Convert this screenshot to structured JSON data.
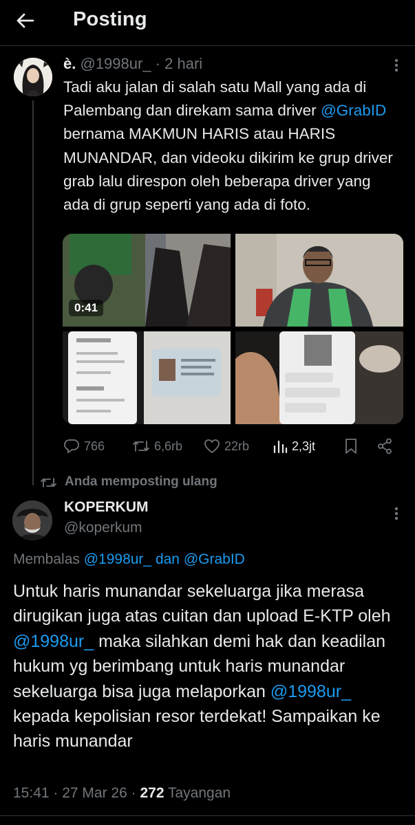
{
  "header": {
    "title": "Posting"
  },
  "tweet1": {
    "name": "è.",
    "handle": "@1998ur_",
    "sep": "·",
    "time": "2 hari",
    "text_pre": "Tadi aku jalan di salah satu Mall yang ada di Palembang dan direkam sama driver ",
    "mention": "@GrabID",
    "text_post": " bernama MAKMUN HARIS atau HARIS MUNANDAR, dan videoku dikirim ke grup driver grab lalu direspon oleh beberapa driver yang ada di grup seperti yang ada di foto.",
    "video_duration": "0:41",
    "actions": {
      "replies": "766",
      "reposts": "6,6rb",
      "likes": "22rb",
      "views": "2,3jt"
    }
  },
  "repost_label": "Anda memposting ulang",
  "tweet2": {
    "name": "KOPERKUM",
    "handle": "@koperkum",
    "reply_prefix": "Membalas",
    "reply_mention1": "@1998ur_",
    "reply_and": "dan",
    "reply_mention2": "@GrabID",
    "text_a": "Untuk haris munandar sekeluarga jika merasa dirugikan juga atas cuitan dan upload E-KTP oleh ",
    "mention_a": "@1998ur_",
    "text_b": " maka silahkan demi hak dan keadilan hukum yg berimbang untuk haris munandar sekeluarga bisa juga melaporkan ",
    "mention_b": "@1998ur_",
    "text_c": " kepada kepolisian resor terdekat! Sampaikan ke haris munandar",
    "time": "15:41",
    "date": "27 Mar 26",
    "views_count": "272",
    "views_label": "Tayangan"
  },
  "colors": {
    "background": "#000000",
    "text": "#e7e9ea",
    "muted": "#71767b",
    "link": "#1d9bf0",
    "divider": "#2f3336"
  },
  "icons": [
    "back-arrow-icon",
    "more-icon",
    "reply-icon",
    "repost-icon",
    "like-icon",
    "views-icon",
    "bookmark-icon",
    "share-icon"
  ]
}
